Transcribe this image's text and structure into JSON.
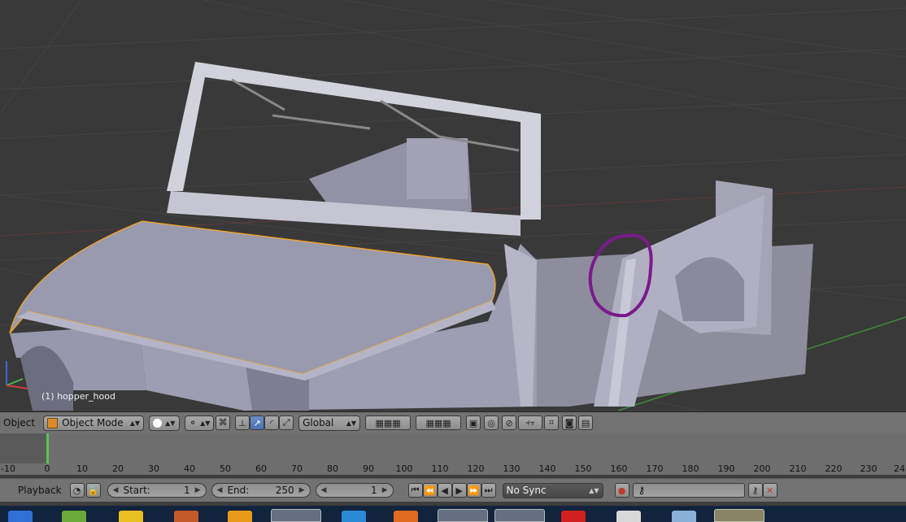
{
  "viewport": {
    "object_label": "(1) hopper_hood"
  },
  "header": {
    "editor_label": "Object",
    "mode_label": "Object Mode",
    "orientation_label": "Global"
  },
  "timeline": {
    "ruler_labels": [
      "-10",
      "0",
      "10",
      "20",
      "30",
      "40",
      "50",
      "60",
      "70",
      "80",
      "90",
      "100",
      "110",
      "120",
      "130",
      "140",
      "150",
      "160",
      "170",
      "180",
      "190",
      "200",
      "210",
      "220",
      "230",
      "24"
    ]
  },
  "playback": {
    "menu_label": "Playback",
    "start_label": "Start:",
    "start_value": "1",
    "end_label": "End:",
    "end_value": "250",
    "current_frame": "1",
    "sync_label": "No Sync"
  },
  "colors": {
    "selection": "#f5a623",
    "annotation": "#7a1a8c",
    "mesh": "#b8b8c8",
    "accent": "#5680c2"
  }
}
